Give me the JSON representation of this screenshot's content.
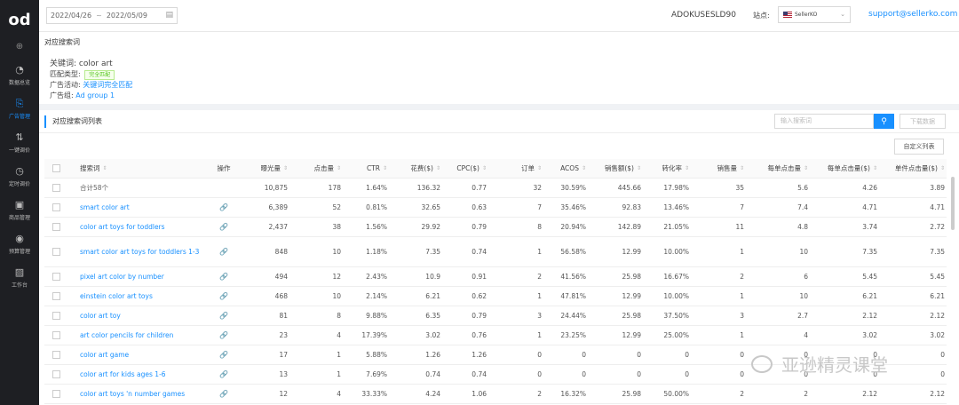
{
  "sidebar": {
    "logo": "od",
    "toggle_icon": "⊕",
    "items": [
      {
        "label": "数据总览",
        "icon": "dashboard-icon",
        "glyph": "◔"
      },
      {
        "label": "广告管理",
        "icon": "ad-icon",
        "glyph": "⎘"
      },
      {
        "label": "一键调价",
        "icon": "price-icon",
        "glyph": "⇅"
      },
      {
        "label": "定时调价",
        "icon": "clock-icon",
        "glyph": "◷"
      },
      {
        "label": "商品管理",
        "icon": "goods-icon",
        "glyph": "▣"
      },
      {
        "label": "预算管理",
        "icon": "budget-icon",
        "glyph": "◉"
      },
      {
        "label": "工作台",
        "icon": "workbench-icon",
        "glyph": "▨"
      }
    ],
    "active_index": 1
  },
  "topbar": {
    "date_start": "2022/04/26",
    "date_sep": "~",
    "date_end": "2022/05/09",
    "account": "ADOKUSESLD90",
    "site_label": "站点:",
    "site_value": "SellerKO",
    "email": "support@sellerko.com"
  },
  "detail": {
    "title": "对应搜索词",
    "keyword_label": "关键词:",
    "keyword_value": "color art",
    "match_label": "匹配类型:",
    "match_value": "完全匹配",
    "campaign_label": "广告活动:",
    "campaign_value": "关键词完全匹配",
    "adgroup_label": "广告组:",
    "adgroup_value": "Ad group 1"
  },
  "list": {
    "title": "对应搜索词列表",
    "search_placeholder": "输入搜索词",
    "search_icon": "⚲",
    "batch_label": "下载数据",
    "custom_columns_label": "自定义列表",
    "columns": [
      "搜索词",
      "操作",
      "曝光量",
      "点击量",
      "CTR",
      "花费($)",
      "CPC($)",
      "订单",
      "ACOS",
      "销售额($)",
      "转化率",
      "销售量",
      "每单点击量",
      "每单点击量($)",
      "单件点击量($)"
    ],
    "sort_glyph": "⇕",
    "link_glyph": "🔗",
    "rows": [
      {
        "kw": "合计58个",
        "op": "",
        "imp": "10,875",
        "clk": "178",
        "ctr": "1.64%",
        "spend": "136.32",
        "cpc": "0.77",
        "ord": "32",
        "acos": "30.59%",
        "sales": "445.66",
        "cvr": "17.98%",
        "units": "35",
        "cpo": "5.6",
        "cpo_usd": "4.26",
        "cpu": "3.89"
      },
      {
        "kw": "smart color art",
        "op": "🔗",
        "imp": "6,389",
        "clk": "52",
        "ctr": "0.81%",
        "spend": "32.65",
        "cpc": "0.63",
        "ord": "7",
        "acos": "35.46%",
        "sales": "92.83",
        "cvr": "13.46%",
        "units": "7",
        "cpo": "7.4",
        "cpo_usd": "4.71",
        "cpu": "4.71"
      },
      {
        "kw": "color art toys for toddlers",
        "op": "🔗",
        "imp": "2,437",
        "clk": "38",
        "ctr": "1.56%",
        "spend": "29.92",
        "cpc": "0.79",
        "ord": "8",
        "acos": "20.94%",
        "sales": "142.89",
        "cvr": "21.05%",
        "units": "11",
        "cpo": "4.8",
        "cpo_usd": "3.74",
        "cpu": "2.72"
      },
      {
        "kw": "smart color art toys for toddlers 1-3",
        "op": "🔗",
        "imp": "848",
        "clk": "10",
        "ctr": "1.18%",
        "spend": "7.35",
        "cpc": "0.74",
        "ord": "1",
        "acos": "56.58%",
        "sales": "12.99",
        "cvr": "10.00%",
        "units": "1",
        "cpo": "10",
        "cpo_usd": "7.35",
        "cpu": "7.35"
      },
      {
        "kw": "pixel art color by number",
        "op": "🔗",
        "imp": "494",
        "clk": "12",
        "ctr": "2.43%",
        "spend": "10.9",
        "cpc": "0.91",
        "ord": "2",
        "acos": "41.56%",
        "sales": "25.98",
        "cvr": "16.67%",
        "units": "2",
        "cpo": "6",
        "cpo_usd": "5.45",
        "cpu": "5.45"
      },
      {
        "kw": "einstein color art toys",
        "op": "🔗",
        "imp": "468",
        "clk": "10",
        "ctr": "2.14%",
        "spend": "6.21",
        "cpc": "0.62",
        "ord": "1",
        "acos": "47.81%",
        "sales": "12.99",
        "cvr": "10.00%",
        "units": "1",
        "cpo": "10",
        "cpo_usd": "6.21",
        "cpu": "6.21"
      },
      {
        "kw": "color art toy",
        "op": "🔗",
        "imp": "81",
        "clk": "8",
        "ctr": "9.88%",
        "spend": "6.35",
        "cpc": "0.79",
        "ord": "3",
        "acos": "24.44%",
        "sales": "25.98",
        "cvr": "37.50%",
        "units": "3",
        "cpo": "2.7",
        "cpo_usd": "2.12",
        "cpu": "2.12"
      },
      {
        "kw": "art color pencils for children",
        "op": "🔗",
        "imp": "23",
        "clk": "4",
        "ctr": "17.39%",
        "spend": "3.02",
        "cpc": "0.76",
        "ord": "1",
        "acos": "23.25%",
        "sales": "12.99",
        "cvr": "25.00%",
        "units": "1",
        "cpo": "4",
        "cpo_usd": "3.02",
        "cpu": "3.02"
      },
      {
        "kw": "color art game",
        "op": "🔗",
        "imp": "17",
        "clk": "1",
        "ctr": "5.88%",
        "spend": "1.26",
        "cpc": "1.26",
        "ord": "0",
        "acos": "0",
        "sales": "0",
        "cvr": "0",
        "units": "0",
        "cpo": "0",
        "cpo_usd": "0",
        "cpu": "0"
      },
      {
        "kw": "color art for kids ages 1-6",
        "op": "🔗",
        "imp": "13",
        "clk": "1",
        "ctr": "7.69%",
        "spend": "0.74",
        "cpc": "0.74",
        "ord": "0",
        "acos": "0",
        "sales": "0",
        "cvr": "0",
        "units": "0",
        "cpo": "0",
        "cpo_usd": "0",
        "cpu": "0"
      },
      {
        "kw": "color art toys 'n number games",
        "op": "🔗",
        "imp": "12",
        "clk": "4",
        "ctr": "33.33%",
        "spend": "4.24",
        "cpc": "1.06",
        "ord": "2",
        "acos": "16.32%",
        "sales": "25.98",
        "cvr": "50.00%",
        "units": "2",
        "cpo": "2",
        "cpo_usd": "2.12",
        "cpu": "2.12"
      }
    ]
  },
  "watermark": {
    "text": "亚逊精灵课堂"
  }
}
